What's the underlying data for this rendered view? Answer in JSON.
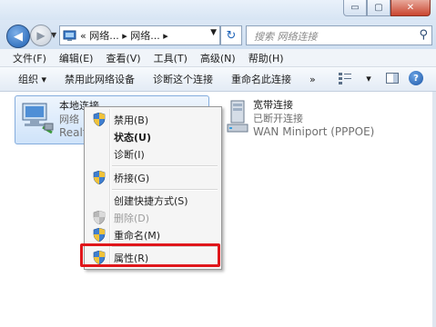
{
  "window": {
    "buttons": {
      "minimize": "▭",
      "maximize": "▢",
      "close": "✕"
    }
  },
  "address": {
    "path_prefix": "«",
    "crumb1": "网络...",
    "crumb2": "网络...",
    "sep": "▸",
    "search_placeholder": "搜索 网络连接"
  },
  "menu": [
    "文件(F)",
    "编辑(E)",
    "查看(V)",
    "工具(T)",
    "高级(N)",
    "帮助(H)"
  ],
  "commands": [
    "组织 ▾",
    "禁用此网络设备",
    "诊断这个连接",
    "重命名此连接",
    "»"
  ],
  "connections": [
    {
      "name": "本地连接",
      "status": "网络",
      "device": "Realte"
    },
    {
      "name": "宽带连接",
      "status": "已断开连接",
      "device": "WAN Miniport (PPPOE)"
    }
  ],
  "context_menu": {
    "items": [
      {
        "label": "禁用(B)",
        "shield": true,
        "bold": false,
        "disabled": false
      },
      {
        "label": "状态(U)",
        "shield": false,
        "bold": true,
        "disabled": false
      },
      {
        "label": "诊断(I)",
        "shield": false,
        "bold": false,
        "disabled": false
      },
      {
        "label": "桥接(G)",
        "shield": true,
        "bold": false,
        "disabled": false
      },
      {
        "label": "创建快捷方式(S)",
        "shield": false,
        "bold": false,
        "disabled": false
      },
      {
        "label": "删除(D)",
        "shield": true,
        "bold": false,
        "disabled": true
      },
      {
        "label": "重命名(M)",
        "shield": true,
        "bold": false,
        "disabled": false
      },
      {
        "label": "属性(R)",
        "shield": true,
        "bold": false,
        "disabled": false
      }
    ]
  },
  "colors": {
    "highlight_border": "#e0161b",
    "selection": "#cfe3fa"
  }
}
